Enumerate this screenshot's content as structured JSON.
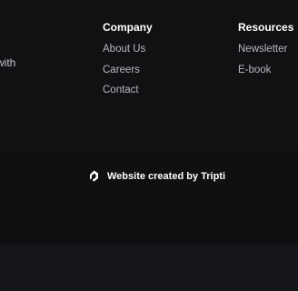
{
  "footer": {
    "clipped_text": "with",
    "company": {
      "heading": "Company",
      "links": [
        "About Us",
        "Careers",
        "Contact"
      ]
    },
    "resources": {
      "heading": "Resources",
      "links": [
        "Newsletter",
        "E-book"
      ]
    }
  },
  "credit": {
    "icon": "logo-icon",
    "text": "Website created by Tripti"
  },
  "colors": {
    "background": "#131417",
    "footer_top": "#111114",
    "credit_band": "#0f1012",
    "heading": "#ffffff",
    "link": "#b6b8bd"
  }
}
